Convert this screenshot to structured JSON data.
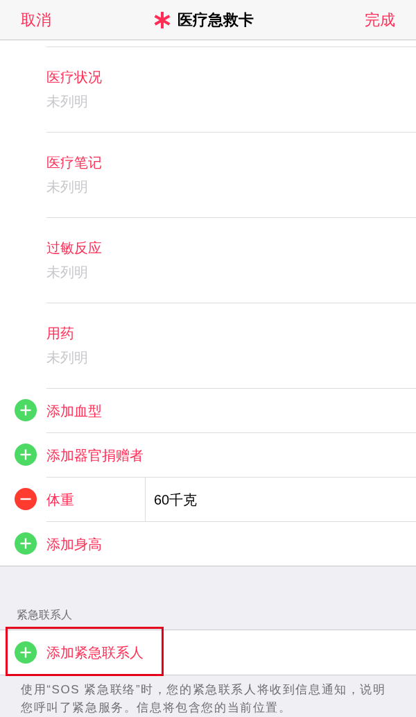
{
  "nav_bar": {
    "cancel": "取消",
    "title": "医疗急救卡",
    "done": "完成"
  },
  "fields": [
    {
      "label": "医疗状况",
      "placeholder": "未列明"
    },
    {
      "label": "医疗笔记",
      "placeholder": "未列明"
    },
    {
      "label": "过敏反应",
      "placeholder": "未列明"
    },
    {
      "label": "用药",
      "placeholder": "未列明"
    }
  ],
  "health_rows": [
    {
      "kind": "add",
      "label": "添加血型"
    },
    {
      "kind": "add",
      "label": "添加器官捐赠者"
    },
    {
      "kind": "remove",
      "label": "体重",
      "value": "60千克"
    },
    {
      "kind": "add",
      "label": "添加身高"
    }
  ],
  "emergency_contacts": {
    "header": "紧急联系人",
    "rows": [
      {
        "kind": "add",
        "label": "添加紧急联系人",
        "highlighted": true
      }
    ],
    "footer": "使用“SOS 紧急联络”时，您的紧急联系人将收到信息通知，说明您呼叫了紧急服务。信息将包含您的当前位置。"
  }
}
